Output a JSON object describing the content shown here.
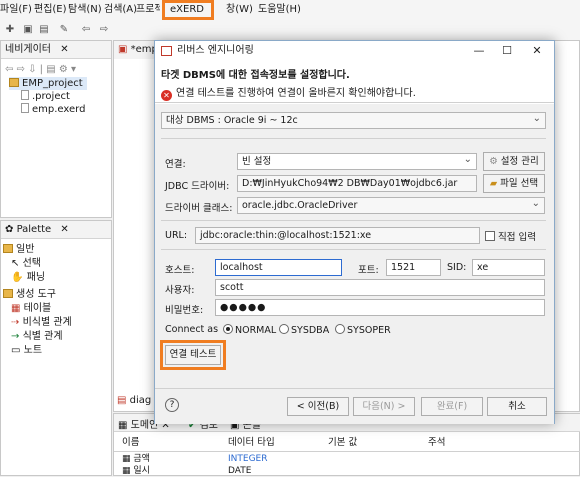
{
  "menubar": {
    "items": [
      "파일(F)",
      "편집(E)",
      "탐색(N)",
      "검색(A)",
      "프로젝트(P)",
      "eXERD",
      "창(W)",
      "도움말(H)"
    ],
    "active_item": "eXERD"
  },
  "navigator": {
    "title": "네비게이터",
    "tree": [
      "EMP_project",
      ".project",
      "emp.exerd"
    ]
  },
  "palette": {
    "title": "Palette",
    "items": [
      "일반",
      "선택",
      "패닝",
      "생성 도구",
      "테이블",
      "비식별 관계",
      "식별 관계",
      "노트"
    ]
  },
  "editor": {
    "tab_label": "*emp",
    "lower_tab": "diag"
  },
  "bottom_panel": {
    "tabs": [
      "도메인",
      "검토",
      "콘솔"
    ],
    "columns": [
      "이름",
      "데이터 타입",
      "기본 값",
      "주석"
    ],
    "rows": [
      {
        "name": "금액",
        "type": "INTEGER"
      },
      {
        "name": "일시",
        "type": "DATE"
      }
    ]
  },
  "dialog": {
    "title": "리버스 엔지니어링",
    "heading": "타겟 DBMS에 대한 접속정보를 설정합니다.",
    "error": "연결 테스트를 진행하여 연결이 올바른지 확인해야합니다.",
    "target_label": "대상 DBMS :",
    "target_value": "Oracle 9i ~ 12c",
    "connection_label": "연결:",
    "connection_value": "빈 설정",
    "settings_button": "설정 관리",
    "jdbc_label": "JDBC 드라이버:",
    "jdbc_value": "D:₩JinHyukCho94₩2 DB₩Day01₩ojdbc6.jar",
    "file_button": "파일 선택",
    "driver_label": "드라이버 클래스:",
    "driver_value": "oracle.jdbc.OracleDriver",
    "url_label": "URL:",
    "url_value": "jdbc:oracle:thin:@localhost:1521:xe",
    "direct_input_label": "직접 입력",
    "host_label": "호스트:",
    "host_value": "localhost",
    "port_label": "포트:",
    "port_value": "1521",
    "sid_label": "SID:",
    "sid_value": "xe",
    "user_label": "사용자:",
    "user_value": "scott",
    "password_label": "비밀번호:",
    "password_value": "●●●●●",
    "connect_as_label": "Connect as",
    "connect_as_options": [
      "NORMAL",
      "SYSDBA",
      "SYSOPER"
    ],
    "connect_as_selected": "NORMAL",
    "test_button": "연결 테스트",
    "back_button": "< 이전(B)",
    "next_button": "다음(N) >",
    "finish_button": "완료(F)",
    "cancel_button": "취소",
    "highlight_color": "#f07d21"
  }
}
